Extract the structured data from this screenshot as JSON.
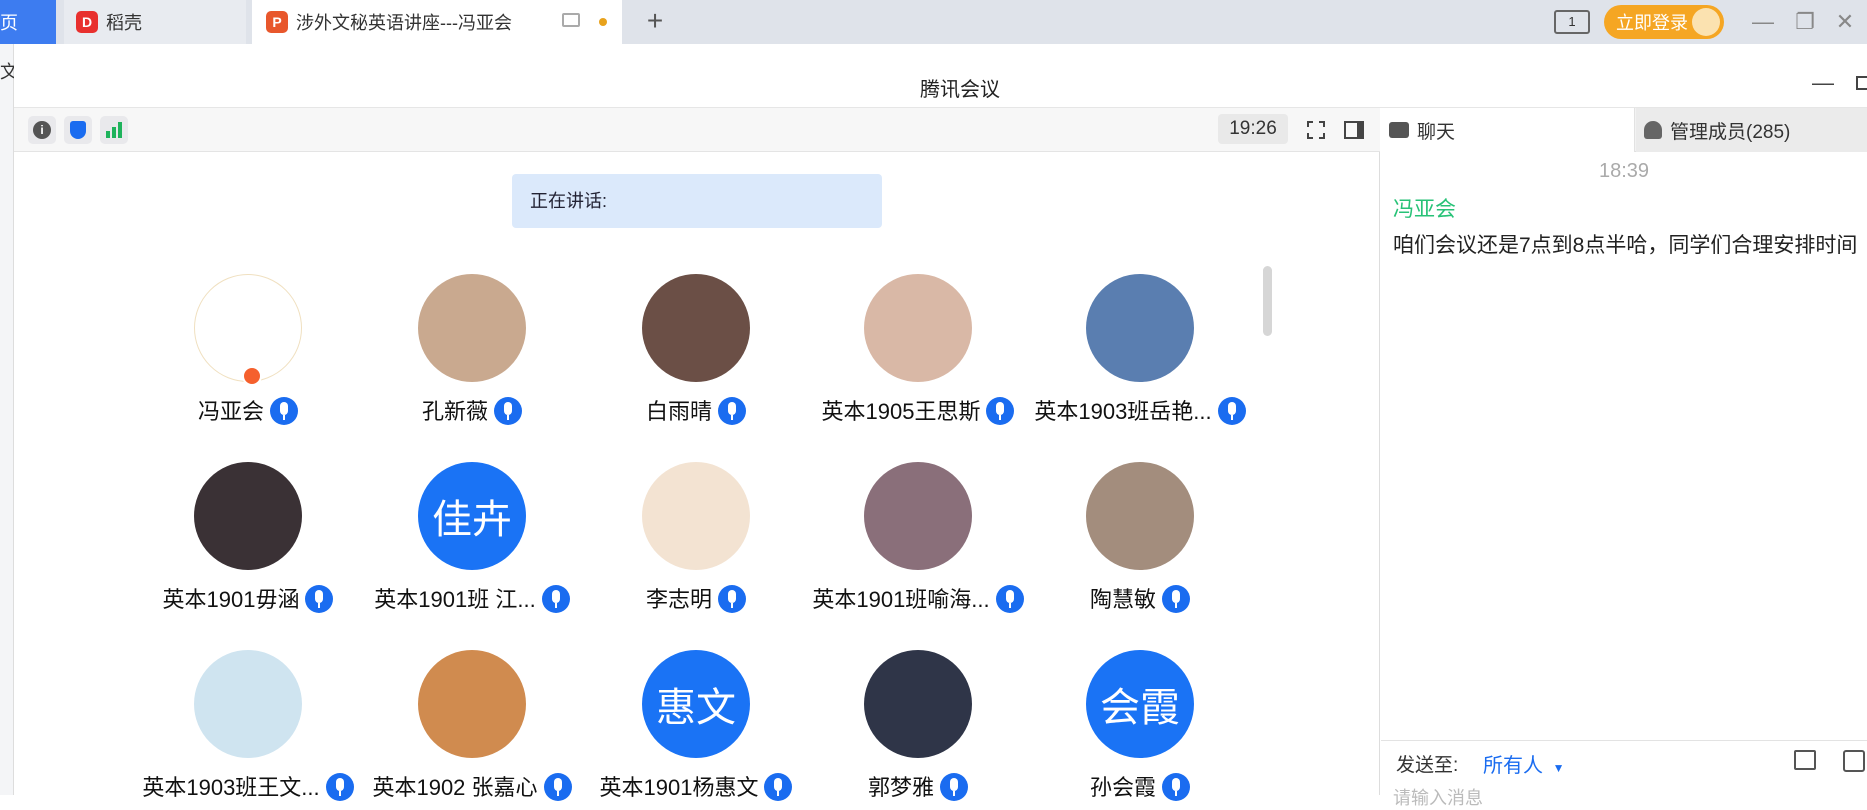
{
  "browser": {
    "tabs": [
      {
        "label": "页",
        "active": false
      },
      {
        "label": "稻壳",
        "active": false
      },
      {
        "label": "涉外文秘英语讲座---冯亚会",
        "active": true
      }
    ],
    "new_tab": "+",
    "login_label": "立即登录",
    "layout_badge": "1"
  },
  "left_strip_text": "文",
  "meeting": {
    "title": "腾讯会议",
    "timer": "19:26",
    "speaking_label": "正在讲话:",
    "participants": [
      {
        "name": "冯亚会",
        "avatar_text": "",
        "color": "#ffffff",
        "host": true
      },
      {
        "name": "孔新薇",
        "avatar_text": "",
        "color": "#c9a98f"
      },
      {
        "name": "白雨晴",
        "avatar_text": "",
        "color": "#6b4f46"
      },
      {
        "name": "英本1905王思斯",
        "avatar_text": "",
        "color": "#d9b8a6"
      },
      {
        "name": "英本1903班岳艳...",
        "avatar_text": "",
        "color": "#5a7eb0"
      },
      {
        "name": "英本1901毋涵",
        "avatar_text": "",
        "color": "#3a3135"
      },
      {
        "name": "英本1901班 江...",
        "avatar_text": "佳卉",
        "color": "#1a73f5"
      },
      {
        "name": "李志明",
        "avatar_text": "",
        "color": "#f3e3d2"
      },
      {
        "name": "英本1901班喻海...",
        "avatar_text": "",
        "color": "#8a6f7a"
      },
      {
        "name": "陶慧敏",
        "avatar_text": "",
        "color": "#a38d7d"
      },
      {
        "name": "英本1903班王文...",
        "avatar_text": "",
        "color": "#cfe4f0"
      },
      {
        "name": "英本1902 张嘉心",
        "avatar_text": "",
        "color": "#d08b4f"
      },
      {
        "name": "英本1901杨惠文",
        "avatar_text": "惠文",
        "color": "#1a73f5"
      },
      {
        "name": "郭梦雅",
        "avatar_text": "",
        "color": "#2f3548"
      },
      {
        "name": "孙会霞",
        "avatar_text": "会霞",
        "color": "#1a73f5"
      }
    ]
  },
  "panel": {
    "chat_tab": "聊天",
    "members_tab": "管理成员(285)",
    "messages": [
      {
        "time": "18:39",
        "sender": "冯亚会",
        "text": "咱们会议还是7点到8点半哈，同学们合理安排时间"
      }
    ],
    "send_label": "发送至:",
    "send_target": "所有人",
    "input_placeholder": "请输入消息"
  },
  "colors": {
    "accent": "#1a6cf0",
    "sender": "#27c277",
    "login": "#f5a623"
  }
}
